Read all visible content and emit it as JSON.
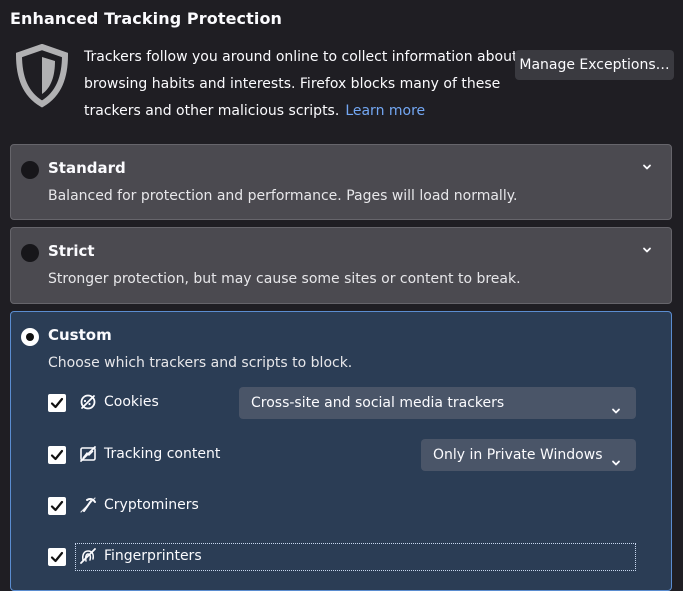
{
  "header": {
    "title": "Enhanced Tracking Protection"
  },
  "intro": {
    "line1": "Trackers follow you around online to collect information about your",
    "line2": "browsing habits and interests. Firefox blocks many of these",
    "line3": "trackers and other malicious scripts.",
    "learn_more": "Learn more"
  },
  "manage_button": {
    "label": "Manage Exceptions…"
  },
  "options": {
    "standard": {
      "title": "Standard",
      "description": "Balanced for protection and performance. Pages will load normally."
    },
    "strict": {
      "title": "Strict",
      "description": "Stronger protection, but may cause some sites or content to break."
    },
    "custom": {
      "title": "Custom",
      "description": "Choose which trackers and scripts to block."
    }
  },
  "trackers": {
    "cookies": {
      "label": "Cookies",
      "select_value": "Cross-site and social media trackers"
    },
    "tracking_content": {
      "label": "Tracking content",
      "select_value": "Only in Private Windows"
    },
    "cryptominers": {
      "label": "Cryptominers"
    },
    "fingerprinters": {
      "label": "Fingerprinters"
    }
  },
  "icons": {
    "shield": "shield-icon",
    "chevron": "chevron-down-icon",
    "checkmark": "checkmark-icon",
    "cookie": "cookie-icon",
    "tracking": "tracking-content-icon",
    "cryptominer": "cryptominer-icon",
    "fingerprint": "fingerprint-icon"
  },
  "colors": {
    "background": "#1f1e23",
    "card": "#4b4a50",
    "selected_card": "#2b3d55",
    "selected_border": "#5b8dd0",
    "link": "#73a7f3"
  }
}
